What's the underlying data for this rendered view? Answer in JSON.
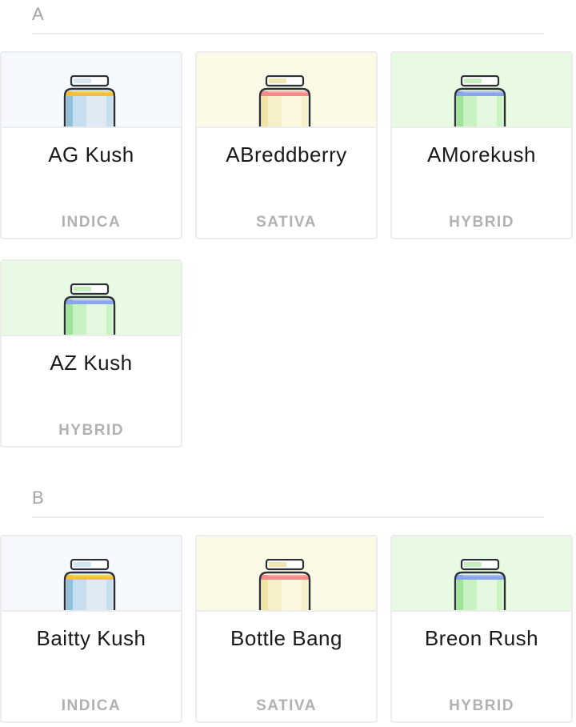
{
  "types": {
    "indica": {
      "label": "INDICA",
      "bg": "#f5f8fc",
      "band": "#f2c230",
      "body": "#dfeaf5",
      "stripe1": "#8ec0d8",
      "stripe2": "#c7def0",
      "lidfill": "#d5e6f3"
    },
    "sativa": {
      "label": "SATIVA",
      "bg": "#fafae6",
      "band": "#f58a8a",
      "body": "#fbf8df",
      "stripe1": "#f0e4a2",
      "stripe2": "#f6f0c8",
      "lidfill": "#efe6b0"
    },
    "hybrid": {
      "label": "HYBRID",
      "bg": "#e8fae3",
      "band": "#8aa4ee",
      "body": "#e3f8df",
      "stripe1": "#9ee59a",
      "stripe2": "#c8f2c2",
      "lidfill": "#c5f0c0"
    }
  },
  "sections": [
    {
      "letter": "A",
      "strains": [
        {
          "name": "AG Kush",
          "type": "indica"
        },
        {
          "name": "ABreddberry",
          "type": "sativa"
        },
        {
          "name": "AMorekush",
          "type": "hybrid"
        },
        {
          "name": "AZ Kush",
          "type": "hybrid"
        }
      ]
    },
    {
      "letter": "B",
      "strains": [
        {
          "name": "Baitty Kush",
          "type": "indica"
        },
        {
          "name": "Bottle Bang",
          "type": "sativa"
        },
        {
          "name": "Breon Rush",
          "type": "hybrid"
        }
      ]
    }
  ]
}
